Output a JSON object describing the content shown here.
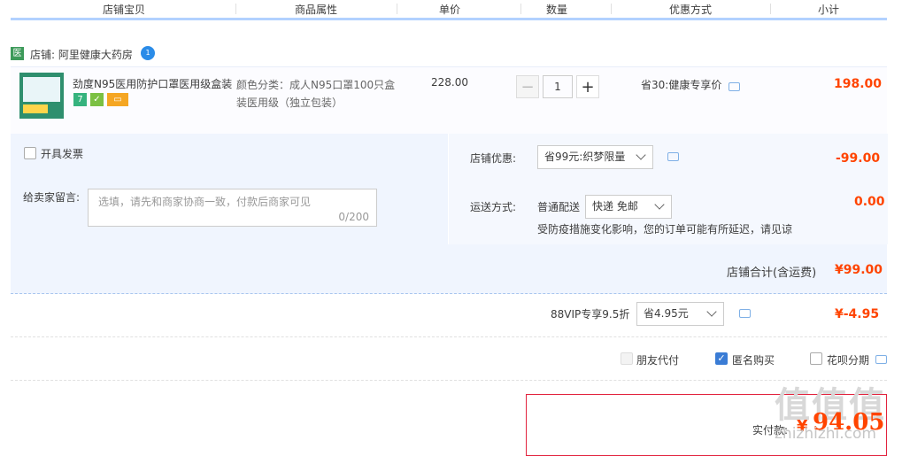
{
  "header": {
    "cols": [
      "店铺宝贝",
      "商品属性",
      "单价",
      "数量",
      "优惠方式",
      "小计"
    ]
  },
  "shop": {
    "icon": "医",
    "label": "店铺: 阿里健康大药房",
    "ww_badge": "1"
  },
  "item": {
    "title": "劲度N95医用防护口罩医用级盒装...",
    "tags": [
      "7",
      "",
      ""
    ],
    "attr_line1": "颜色分类：成人N95口罩100只盒",
    "attr_line2": "装医用级（独立包装）",
    "price": "228.00",
    "minus": "−",
    "qty": "1",
    "plus": "+",
    "promo": "省30:健康专享价",
    "subtotal": "198.00"
  },
  "order": {
    "invoice_label": "开具发票",
    "message_label": "给卖家留言:",
    "message_placeholder": "选填，请先和商家协商一致，付款后商家可见",
    "message_counter": "0/200",
    "shop_discount_label": "店铺优惠:",
    "shop_discount_value": "省99元:织梦限量",
    "shop_discount_amount": "-99.00",
    "shipping_label": "运送方式:",
    "shipping_type": "普通配送",
    "shipping_value": "快递 免邮",
    "shipping_amount": "0.00",
    "shipping_note": "受防疫措施变化影响，您的订单可能有所延迟，请见谅",
    "shop_total_label": "店铺合计(含运费)",
    "shop_total_value": "¥99.00"
  },
  "vip": {
    "label": "88VIP专享9.5折",
    "select_value": "省4.95元",
    "amount": "¥-4.95"
  },
  "options": {
    "friend_pay": "朋友代付",
    "anonymous": "匿名购买",
    "huabei": "花呗分期"
  },
  "pay": {
    "label": "实付款:",
    "currency": "¥",
    "amount": "94.05"
  },
  "watermark": {
    "logo": "值值值",
    "url": "zhizhizhi.com"
  },
  "colors": {
    "accent_red": "#ff4400",
    "header_line": "#b2d1ff",
    "panel_bg": "#f0f5fe"
  }
}
